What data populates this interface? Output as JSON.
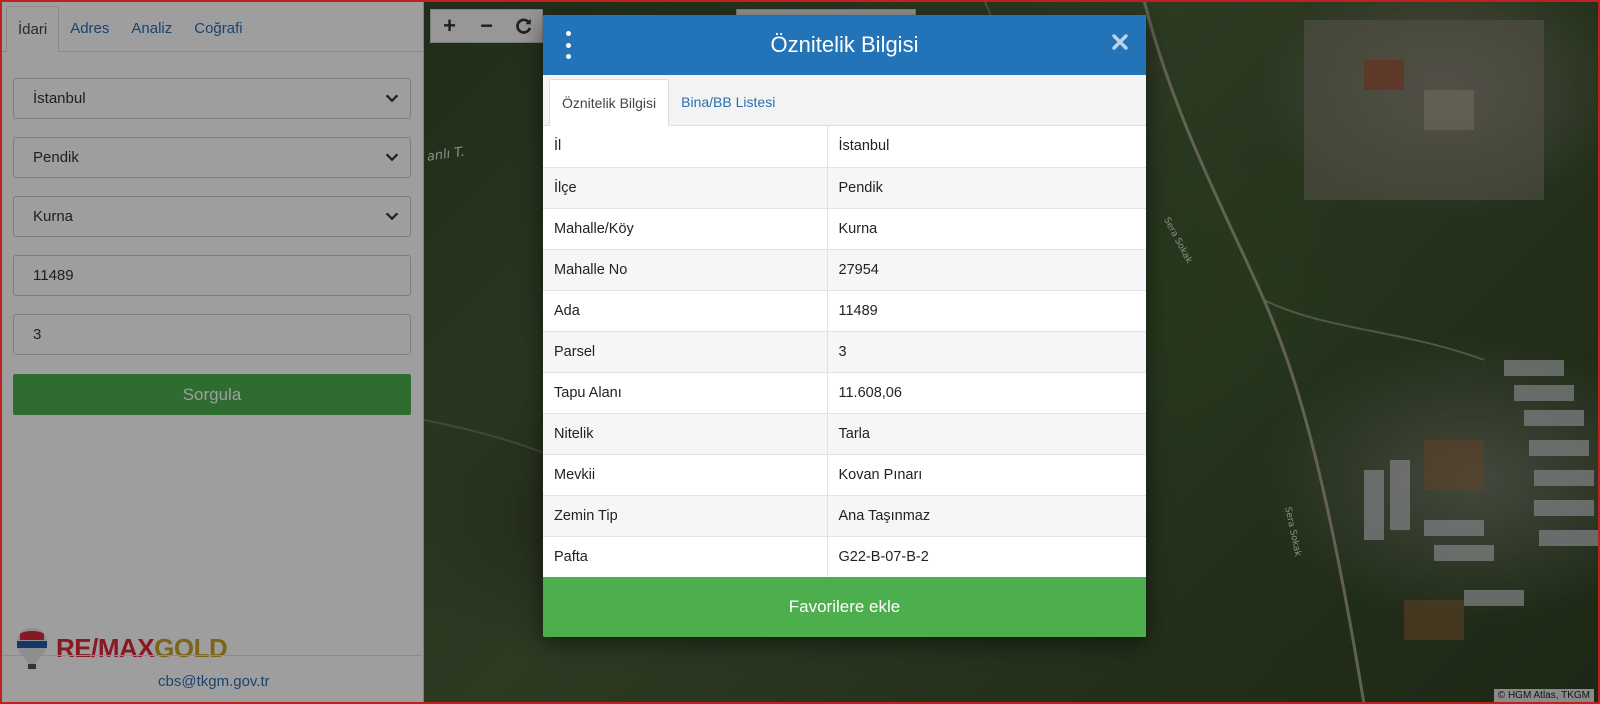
{
  "sidebar": {
    "tabs": [
      {
        "label": "İdari",
        "active": true
      },
      {
        "label": "Adres",
        "active": false
      },
      {
        "label": "Analiz",
        "active": false
      },
      {
        "label": "Coğrafi",
        "active": false
      }
    ],
    "province": "İstanbul",
    "district": "Pendik",
    "neighborhood": "Kurna",
    "block": "11489",
    "parcel": "3",
    "query_button": "Sorgula",
    "brand_main": "RE/MAX",
    "brand_sub": "GOLD",
    "email": "cbs@tkgm.gov.tr"
  },
  "map": {
    "labels": {
      "a": "anlı T.",
      "b": "Sera Sokak",
      "c": "Sera Sokak"
    },
    "attribution": "© HGM Atlas, TKGM"
  },
  "modal": {
    "title": "Öznitelik Bilgisi",
    "tabs": [
      {
        "label": "Öznitelik Bilgisi",
        "active": true
      },
      {
        "label": "Bina/BB Listesi",
        "active": false
      }
    ],
    "rows": [
      {
        "key": "İl",
        "value": "İstanbul"
      },
      {
        "key": "İlçe",
        "value": "Pendik"
      },
      {
        "key": "Mahalle/Köy",
        "value": "Kurna"
      },
      {
        "key": "Mahalle No",
        "value": "27954"
      },
      {
        "key": "Ada",
        "value": "11489"
      },
      {
        "key": "Parsel",
        "value": "3"
      },
      {
        "key": "Tapu Alanı",
        "value": "11.608,06"
      },
      {
        "key": "Nitelik",
        "value": "Tarla"
      },
      {
        "key": "Mevkii",
        "value": "Kovan Pınarı"
      },
      {
        "key": "Zemin Tip",
        "value": "Ana Taşınmaz"
      },
      {
        "key": "Pafta",
        "value": "G22-B-07-B-2"
      }
    ],
    "favorite_button": "Favorilere ekle"
  },
  "colors": {
    "primary": "#2273b8",
    "success": "#4cae4c",
    "brand_red": "#d8293a",
    "brand_gold": "#c9a227",
    "frame": "#c0201f"
  }
}
